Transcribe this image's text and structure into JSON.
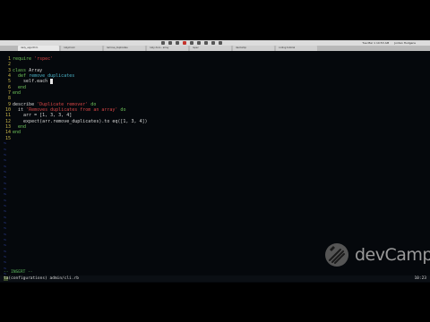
{
  "menubar": {
    "clock": "Tue Mar 1 10:53 AM",
    "user": "Jordan Hudgens"
  },
  "browser_tabs": [
    {
      "label": "daily_algorithm"
    },
    {
      "label": "rubymonk"
    },
    {
      "label": "remove_duplicates"
    },
    {
      "label": "ruby docs - array"
    },
    {
      "label": "rspec"
    },
    {
      "label": "devCamp"
    },
    {
      "label": "coding tutorial"
    }
  ],
  "editor": {
    "lines": [
      {
        "n": "1",
        "parts": [
          {
            "c": "kw",
            "t": "require "
          },
          {
            "c": "str",
            "t": "'rspec'"
          }
        ]
      },
      {
        "n": "2",
        "parts": []
      },
      {
        "n": "3",
        "parts": [
          {
            "c": "kw",
            "t": "class "
          },
          {
            "c": "txt",
            "t": "Array"
          }
        ]
      },
      {
        "n": "4",
        "parts": [
          {
            "c": "kw",
            "t": "  def "
          },
          {
            "c": "sym",
            "t": "remove_duplicates"
          }
        ]
      },
      {
        "n": "5",
        "parts": [
          {
            "c": "txt",
            "t": "    self.each "
          }
        ]
      },
      {
        "n": "6",
        "parts": [
          {
            "c": "kw",
            "t": "  end"
          }
        ]
      },
      {
        "n": "7",
        "parts": [
          {
            "c": "kw",
            "t": "end"
          }
        ]
      },
      {
        "n": "8",
        "parts": []
      },
      {
        "n": "9",
        "parts": [
          {
            "c": "txt",
            "t": "describe "
          },
          {
            "c": "str",
            "t": "'Duplicate remover'"
          },
          {
            "c": "kw",
            "t": " do"
          }
        ]
      },
      {
        "n": "10",
        "parts": [
          {
            "c": "txt",
            "t": "  it "
          },
          {
            "c": "str",
            "t": "'Removes duplicates from an array'"
          },
          {
            "c": "kw",
            "t": " do"
          }
        ]
      },
      {
        "n": "11",
        "parts": [
          {
            "c": "txt",
            "t": "    arr = [1, 3, 3, 4]"
          }
        ]
      },
      {
        "n": "12",
        "parts": [
          {
            "c": "txt",
            "t": "    expect(arr.remove_duplicates).to eq([1, 3, 4])"
          }
        ]
      },
      {
        "n": "13",
        "parts": [
          {
            "c": "kw",
            "t": "  end"
          }
        ]
      },
      {
        "n": "14",
        "parts": [
          {
            "c": "kw",
            "t": "end"
          }
        ]
      },
      {
        "n": "15",
        "parts": []
      }
    ],
    "tilde_count": 30,
    "tilde": "~",
    "mode": "-- INSERT --",
    "cmd_highlight": "ta",
    "cmd_text": "(configurations) admin/cli.rb",
    "position": "10:23"
  },
  "watermark": {
    "text": "devCamp",
    "color": "#9a9a9a"
  },
  "colors": {
    "terminal_bg": "#05080c",
    "line_number": "#c9b64a",
    "keyword": "#6ec35a",
    "string": "#d64545",
    "tilde": "#3a50c8"
  }
}
